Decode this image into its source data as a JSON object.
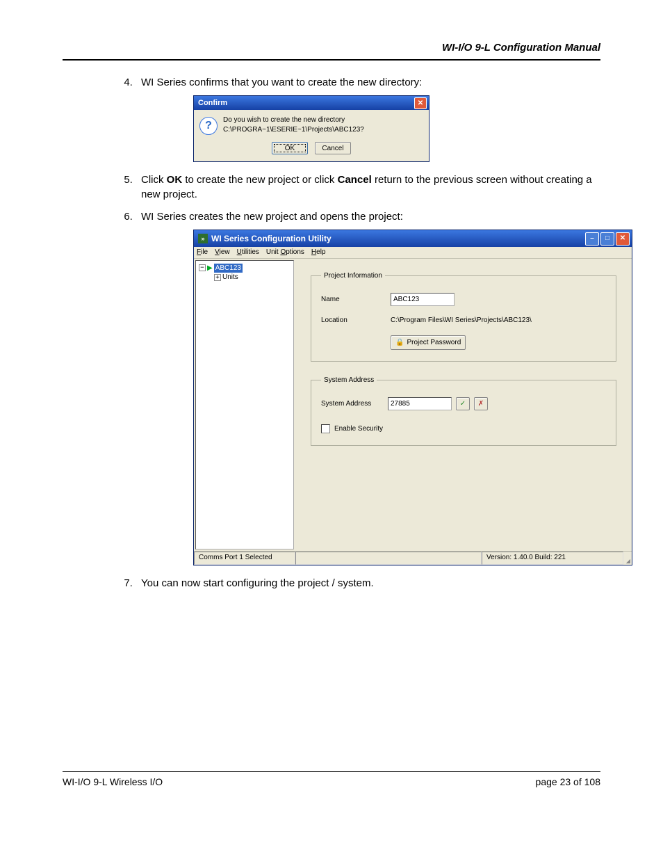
{
  "doc": {
    "header": "WI-I/O 9-L Configuration Manual",
    "footer_left": "WI-I/O 9-L Wireless I/O",
    "footer_right_prefix": "page ",
    "footer_page": "23",
    "footer_of": " of 108"
  },
  "steps": {
    "s4": "WI Series confirms that you want to create the new directory:",
    "s5a": "Click ",
    "s5b": "OK",
    "s5c": " to create the new project or click ",
    "s5d": "Cancel",
    "s5e": " return to the previous screen without creating a new project.",
    "s6": "WI Series creates the new project and opens the project:",
    "s7": "You can now start configuring the project / system."
  },
  "confirm": {
    "title": "Confirm",
    "msg": "Do you wish to create the new directory C:\\PROGRA~1\\ESERIE~1\\Projects\\ABC123?",
    "ok": "OK",
    "cancel": "Cancel"
  },
  "app": {
    "title": "WI Series Configuration Utility",
    "menu": {
      "file": "File",
      "view": "View",
      "util": "Utilities",
      "unit": "Unit Options",
      "help": "Help"
    },
    "tree": {
      "root": "ABC123",
      "child": "Units"
    },
    "groupProjectInfo": "Project Information",
    "nameLabel": "Name",
    "nameValue": "ABC123",
    "locationLabel": "Location",
    "locationValue": "C:\\Program Files\\WI Series\\Projects\\ABC123\\",
    "pwdBtn": "Project Password",
    "groupSysAddr": "System Address",
    "sysAddrLabel": "System Address",
    "sysAddrValue": "27885",
    "enableSecurity": "Enable Security",
    "statusLeft": "Comms Port 1 Selected",
    "statusRight": "Version: 1.40.0 Build: 221"
  }
}
